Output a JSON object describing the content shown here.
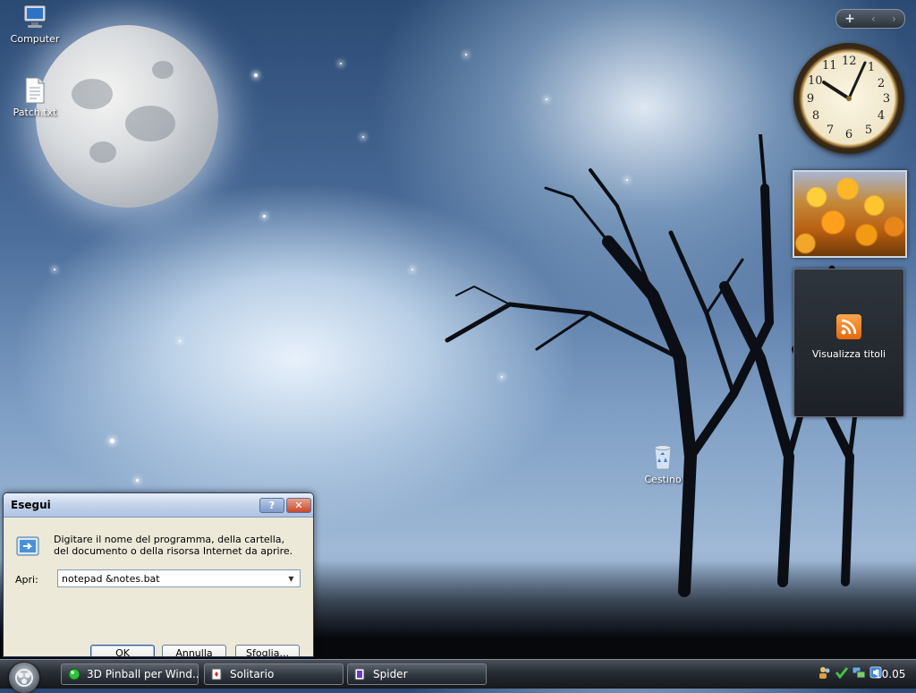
{
  "desktop": {
    "icons": [
      {
        "label": "Computer",
        "icon": "computer-icon"
      },
      {
        "label": "Patch.txt",
        "icon": "text-file-icon"
      },
      {
        "label": "Cestino",
        "icon": "recycle-bin-icon"
      }
    ]
  },
  "gadgets": {
    "toolbar": {
      "add": "+",
      "prev": "‹",
      "next": "›"
    },
    "clock": {
      "numbers": [
        "12",
        "1",
        "2",
        "3",
        "4",
        "5",
        "6",
        "7",
        "8",
        "9",
        "10",
        "11"
      ],
      "time": "10:05"
    },
    "slideshow": {
      "icon": "flower-photo"
    },
    "feed": {
      "label": "Visualizza titoli",
      "icon": "rss-icon"
    }
  },
  "run_dialog": {
    "title": "Esegui",
    "help": "?",
    "close": "✕",
    "description": "Digitare il nome del programma, della cartella, del documento o della risorsa Internet da aprire.",
    "apri_label": "Apri:",
    "input_value": "notepad &notes.bat",
    "ok": "OK",
    "cancel": "Annulla",
    "browse": "Sfoglia..."
  },
  "taskbar": {
    "tasks": [
      {
        "label": "3D Pinball per Wind...",
        "icon": "pinball-icon"
      },
      {
        "label": "Solitario",
        "icon": "solitaire-icon"
      },
      {
        "label": "Spider",
        "icon": "spider-solitaire-icon"
      }
    ],
    "clock": "10.05",
    "colors": {
      "taskbar": "#2a2f36",
      "accent": "#3b5aa0"
    }
  }
}
